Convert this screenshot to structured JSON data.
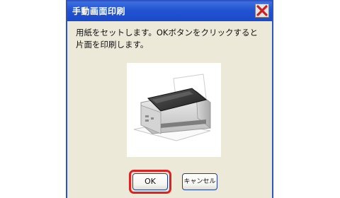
{
  "dialog": {
    "title": "手動画面印刷",
    "close_icon": "close-icon",
    "message_lines": [
      "用紙をセットします。OKボタンをクリックすると",
      "片面を印刷します。"
    ],
    "image_icon": "printer-icon",
    "buttons": {
      "ok_label": "OK",
      "cancel_label": "キャンセル"
    }
  },
  "colors": {
    "titlebar": "#2153d2",
    "dialog_background": "#ece9d8",
    "close_button_x": "#cc1f1f",
    "focus_highlight": "#e02121"
  }
}
